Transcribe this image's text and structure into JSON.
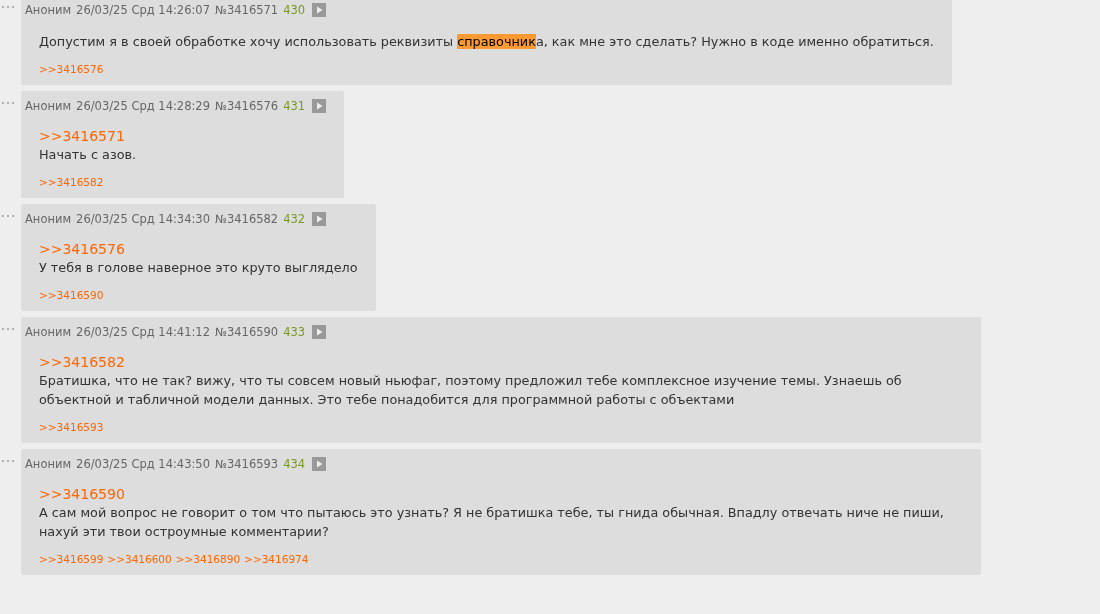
{
  "posts": [
    {
      "author": "Аноним",
      "date": "26/03/25 Срд 14:26:07",
      "number": "№3416571",
      "ordinal": "430",
      "text": [
        {
          "text": "Допустим я в своей обработке хочу использовать реквизиты ",
          "highlighted": false
        },
        {
          "text": "справочник",
          "highlighted": true
        },
        {
          "text": "а, как мне это сделать? Нужно в коде именно обратиться.",
          "highlighted": false
        }
      ],
      "replies": [
        ">>3416576"
      ]
    },
    {
      "author": "Аноним",
      "date": "26/03/25 Срд 14:28:29",
      "number": "№3416576",
      "ordinal": "431",
      "reply_to": ">>3416571",
      "text": [
        {
          "text": "Начать с азов.",
          "highlighted": false
        }
      ],
      "replies": [
        ">>3416582"
      ]
    },
    {
      "author": "Аноним",
      "date": "26/03/25 Срд 14:34:30",
      "number": "№3416582",
      "ordinal": "432",
      "reply_to": ">>3416576",
      "text": [
        {
          "text": "У тебя в голове наверное это круто выглядело",
          "highlighted": false
        }
      ],
      "replies": [
        ">>3416590"
      ]
    },
    {
      "author": "Аноним",
      "date": "26/03/25 Срд 14:41:12",
      "number": "№3416590",
      "ordinal": "433",
      "reply_to": ">>3416582",
      "text": [
        {
          "text": "Братишка, что не так? вижу, что ты совсем новый ньюфаг, поэтому предложил тебе комплексное изучение темы. Узнаешь об объектной и табличной модели данных. Это тебе понадобится для программной работы с объектами",
          "highlighted": false
        }
      ],
      "replies": [
        ">>3416593"
      ]
    },
    {
      "author": "Аноним",
      "date": "26/03/25 Срд 14:43:50",
      "number": "№3416593",
      "ordinal": "434",
      "reply_to": ">>3416590",
      "text": [
        {
          "text": "А сам мой вопрос не говорит о том что пытаюсь это узнать? Я не братишка тебе, ты гнида обычная. Впадлу отвечать ниче не пиши, нахуй эти твои остроумные комментарии?",
          "highlighted": false
        }
      ],
      "replies": [
        ">>3416599",
        ">>3416600",
        ">>3416890",
        ">>3416974"
      ]
    }
  ]
}
